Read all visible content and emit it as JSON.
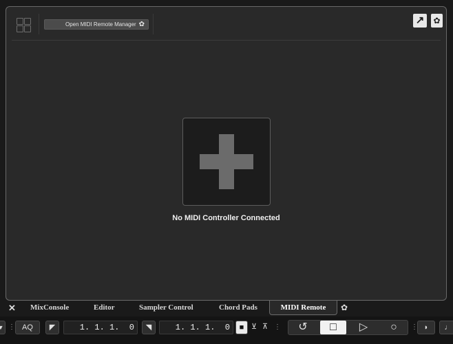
{
  "toolbar": {
    "grid_icon": "grid-icon",
    "open_manager_label": "Open MIDI Remote Manager",
    "settings_icon": "gear-icon",
    "popout_icon": "arrow-up-right-icon"
  },
  "main": {
    "add_icon": "plus-icon",
    "status_text": "No MIDI Controller Connected"
  },
  "tabs": {
    "close_icon": "close-icon",
    "items": [
      "MixConsole",
      "Editor",
      "Sampler Control",
      "Chord Pads",
      "MIDI Remote"
    ],
    "active": "MIDI Remote",
    "settings_icon": "gear-icon"
  },
  "transport": {
    "aq_label": "AQ",
    "left_locator": "1. 1. 1.  0",
    "right_locator": "1. 1. 1.  0",
    "controls": [
      "cycle",
      "stop",
      "play",
      "record"
    ]
  },
  "colors": {
    "panel_bg": "#292929",
    "panel_border": "#6a6a6a",
    "plus_color": "#6b6b6b",
    "active_button": "#f2f2f2"
  }
}
